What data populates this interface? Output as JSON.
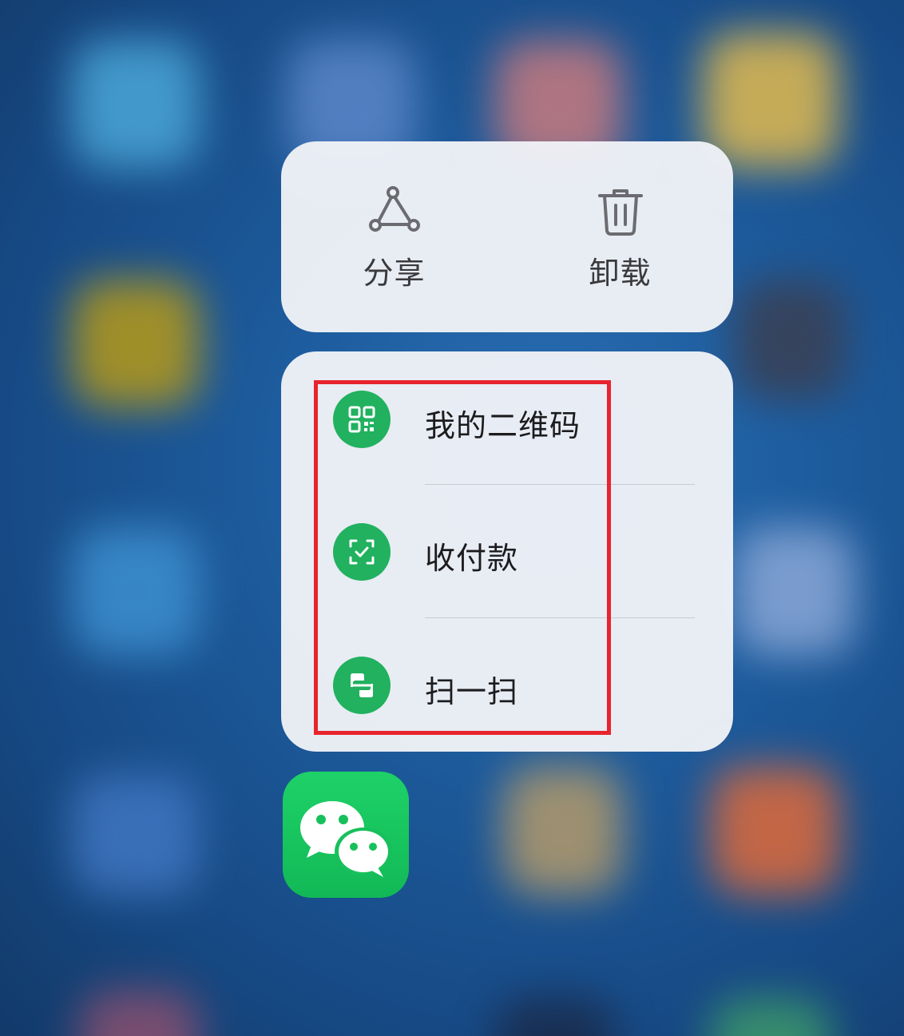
{
  "quick_actions": {
    "share_label": "分享",
    "uninstall_label": "卸载"
  },
  "menu": {
    "items": [
      {
        "label": "我的二维码",
        "icon": "qr-code-icon"
      },
      {
        "label": "收付款",
        "icon": "payment-icon"
      },
      {
        "label": "扫一扫",
        "icon": "scan-icon"
      }
    ]
  },
  "app": {
    "icon": "wechat-icon"
  },
  "colors": {
    "accent_green": "#21b15f",
    "highlight_red": "#e8232d",
    "card_background": "#eef1f6"
  }
}
